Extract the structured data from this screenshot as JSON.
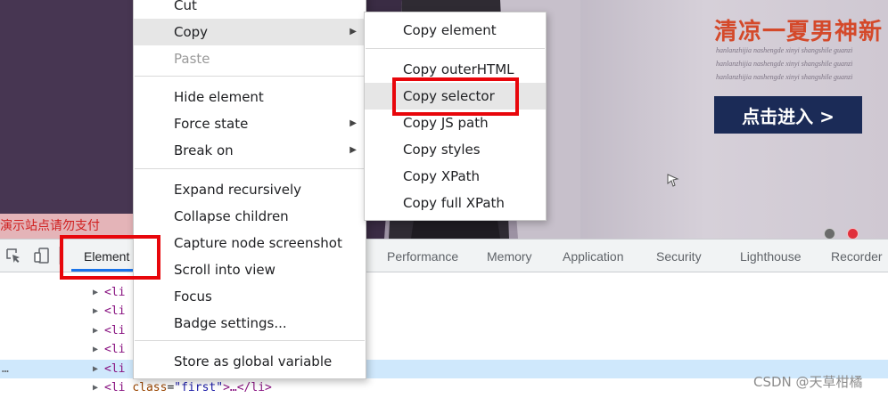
{
  "website": {
    "banner_title": "清凉一夏男神新",
    "pinyin_lines": [
      "hanlanzhijia nashengde xinyi shangshile guanzi",
      "hanlanzhijia nashengde xinyi shangshile guanzi",
      "hanlanzhijia nashengde xinyi shangshile guanzi"
    ],
    "enter_button": "点击进入 >",
    "demo_notice": "演示站点请勿支付"
  },
  "devtools": {
    "tabs": [
      {
        "label": "Element"
      },
      {
        "label": "Performance"
      },
      {
        "label": "Memory"
      },
      {
        "label": "Application"
      },
      {
        "label": "Security"
      },
      {
        "label": "Lighthouse"
      },
      {
        "label": "Recorder"
      }
    ],
    "dom_rows": [
      {
        "text": "<li"
      },
      {
        "text": "<li"
      },
      {
        "text": "<li"
      },
      {
        "text": "<li"
      },
      {
        "text": "<li"
      },
      {
        "tag_open": "<li ",
        "attr_name": "class",
        "attr_eq": "=",
        "attr_value": "\"first\"",
        "tag_rest": ">…</li>"
      }
    ],
    "ellipsis": "…"
  },
  "context_menu": {
    "items": [
      {
        "label": "Cut"
      },
      {
        "label": "Copy"
      },
      {
        "label": "Paste"
      },
      {
        "label": "Hide element"
      },
      {
        "label": "Force state"
      },
      {
        "label": "Break on"
      },
      {
        "label": "Expand recursively"
      },
      {
        "label": "Collapse children"
      },
      {
        "label": "Capture node screenshot"
      },
      {
        "label": "Scroll into view"
      },
      {
        "label": "Focus"
      },
      {
        "label": "Badge settings..."
      },
      {
        "label": "Store as global variable"
      }
    ],
    "copy_submenu": [
      {
        "label": "Copy element"
      },
      {
        "label": "Copy outerHTML"
      },
      {
        "label": "Copy selector"
      },
      {
        "label": "Copy JS path"
      },
      {
        "label": "Copy styles"
      },
      {
        "label": "Copy XPath"
      },
      {
        "label": "Copy full XPath"
      }
    ]
  },
  "watermark": "CSDN @天草柑橘",
  "colors": {
    "annotation_red": "#e8060b",
    "selected_row": "#cfe8fc",
    "tag_purple": "#881280"
  }
}
